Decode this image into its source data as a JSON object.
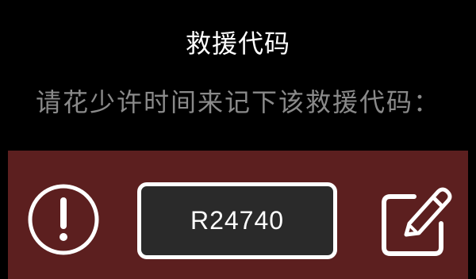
{
  "dialog": {
    "title": "救援代码",
    "message": "请花少许时间来记下该救援代码："
  },
  "rescue_panel": {
    "code": "R24740",
    "warning_icon": "exclamation-circle-icon",
    "edit_icon": "pencil-square-icon"
  },
  "colors": {
    "background": "#000000",
    "panel": "#5c1f1f",
    "code_box": "#2a2a2a",
    "title_text": "#ffffff",
    "message_text": "#8a8a8a"
  }
}
